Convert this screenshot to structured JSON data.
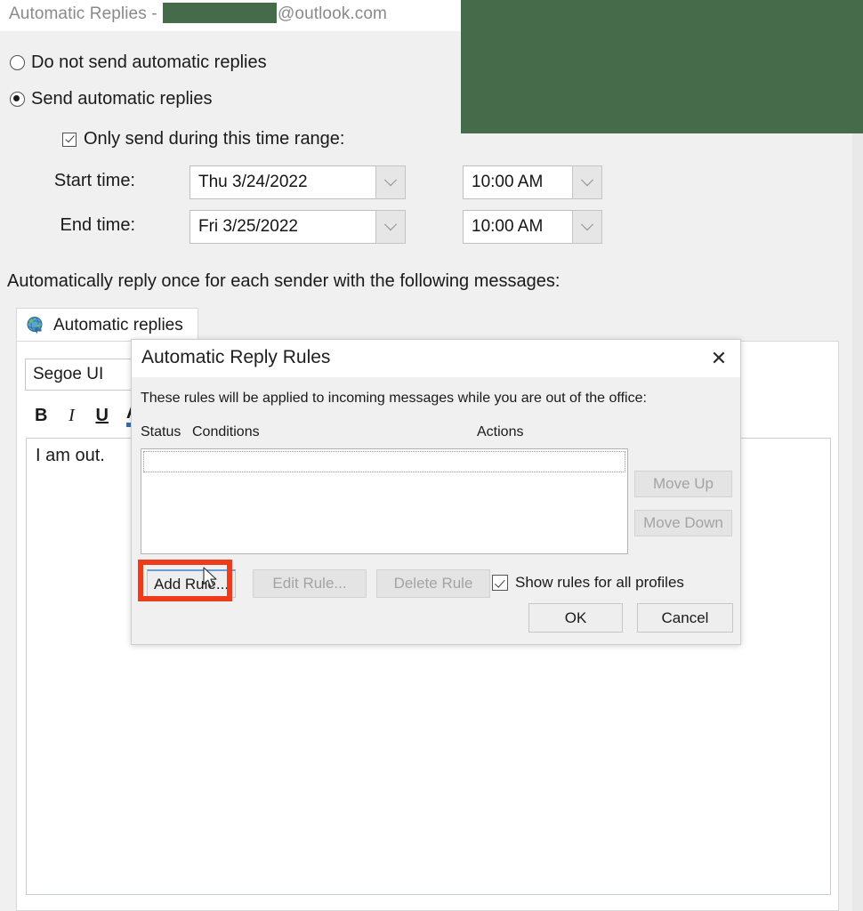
{
  "window": {
    "title_prefix": "Automatic Replies - ",
    "title_domain": "@outlook.com",
    "redaction_color": "#456b4a"
  },
  "options": {
    "do_not_send_label": "Do not send automatic replies",
    "send_label": "Send automatic replies",
    "selected": "send",
    "time_range_label": "Only send during this time range:",
    "time_range_checked": true,
    "start_time_label": "Start time:",
    "end_time_label": "End time:",
    "start_date_value": "Thu 3/24/2022",
    "end_date_value": "Fri 3/25/2022",
    "start_time_value": "10:00 AM",
    "end_time_value": "10:00 AM"
  },
  "note": "Automatically reply once for each sender with the following messages:",
  "editor": {
    "tab_label": "Automatic replies",
    "tab_icon": "globe-reply-icon",
    "font_value": "Segoe UI",
    "bold_label": "B",
    "italic_label": "I",
    "underline_label": "U",
    "font_color_label": "A",
    "font_color_accent": "#3a6ea5",
    "message_body": "I am out."
  },
  "dialog": {
    "title": "Automatic Reply Rules",
    "close_label": "✕",
    "description": "These rules will be applied to incoming messages while you are out of the office:",
    "columns": {
      "status": "Status",
      "conditions": "Conditions",
      "actions": "Actions"
    },
    "rules": [],
    "move_up_label": "Move Up",
    "move_down_label": "Move Down",
    "move_up_enabled": false,
    "move_down_enabled": false,
    "add_rule_label": "Add Rule...",
    "edit_rule_label": "Edit Rule...",
    "delete_rule_label": "Delete Rule",
    "add_rule_enabled": true,
    "edit_rule_enabled": false,
    "delete_rule_enabled": false,
    "show_all_profiles_label": "Show rules for all profiles",
    "show_all_profiles_checked": true,
    "ok_label": "OK",
    "cancel_label": "Cancel"
  },
  "annotation": {
    "highlight_target": "add-rule-button",
    "highlight_color": "#ee3b1c",
    "cursor": "arrow-pointer"
  }
}
